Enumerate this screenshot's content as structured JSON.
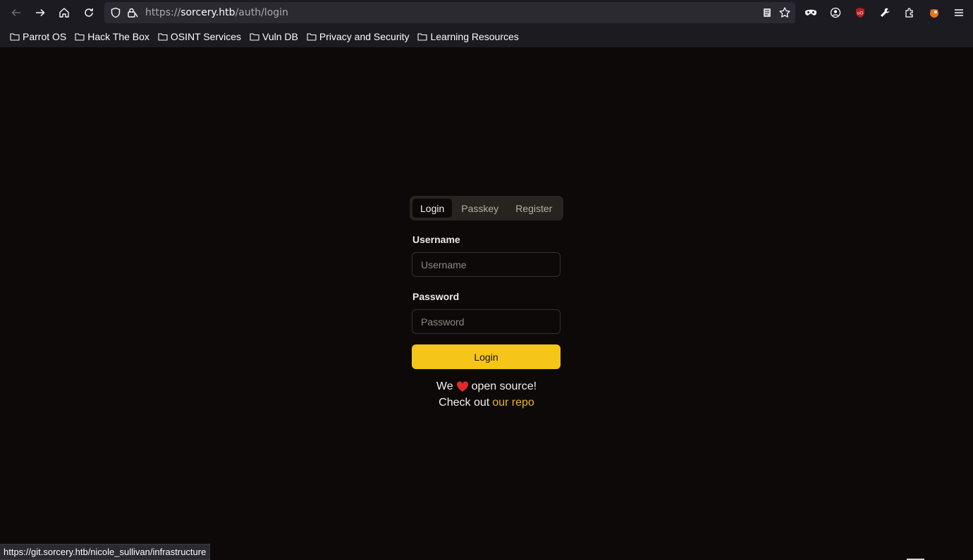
{
  "browser": {
    "url_prefix": "https://",
    "url_host": "sorcery.htb",
    "url_path": "/auth/login"
  },
  "bookmarks": [
    {
      "label": "Parrot OS"
    },
    {
      "label": "Hack The Box"
    },
    {
      "label": "OSINT Services"
    },
    {
      "label": "Vuln DB"
    },
    {
      "label": "Privacy and Security"
    },
    {
      "label": "Learning Resources"
    }
  ],
  "auth": {
    "tabs": [
      {
        "label": "Login",
        "active": true
      },
      {
        "label": "Passkey",
        "active": false
      },
      {
        "label": "Register",
        "active": false
      }
    ],
    "username_label": "Username",
    "username_placeholder": "Username",
    "username_value": "",
    "password_label": "Password",
    "password_placeholder": "Password",
    "password_value": "",
    "submit_label": "Login",
    "oss_line1_before": "We",
    "oss_line1_after": "open source!",
    "oss_line2_before": "Check out",
    "oss_link": "our repo"
  },
  "status_bar": {
    "text": "https://git.sorcery.htb/nicole_sullivan/infrastructure"
  },
  "colors": {
    "accent": "#f5c518",
    "page_bg": "#0c0908",
    "link": "#e8b818"
  },
  "icons": {
    "back": "arrow-left-icon",
    "forward": "arrow-right-icon",
    "home": "home-icon",
    "reload": "reload-icon",
    "heart": "heart-icon"
  }
}
